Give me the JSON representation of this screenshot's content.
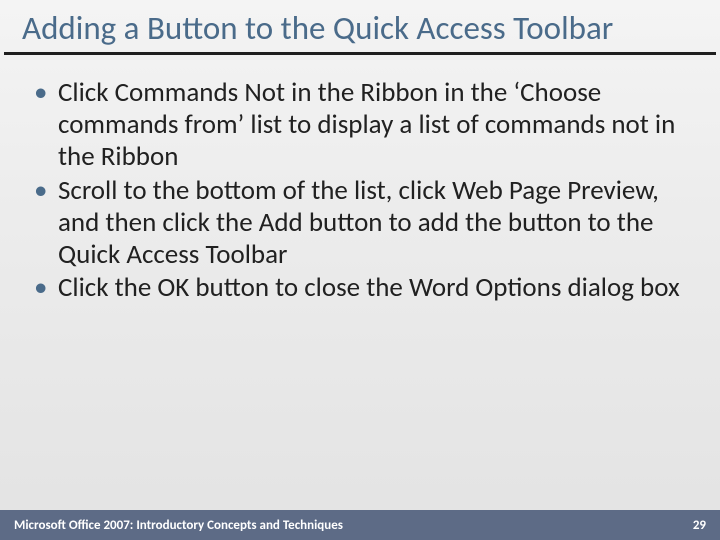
{
  "title": "Adding a Button to the Quick Access Toolbar",
  "bullets": [
    "Click Commands Not in the Ribbon in the ‘Choose commands from’ list to display a list of commands not in the Ribbon",
    "Scroll to the bottom of the list, click Web Page Preview, and then click the Add button to add the button to the Quick Access Toolbar",
    "Click the OK button to close the Word Options dialog box"
  ],
  "footer": {
    "text": "Microsoft Office 2007: Introductory Concepts and Techniques",
    "page": "29"
  }
}
